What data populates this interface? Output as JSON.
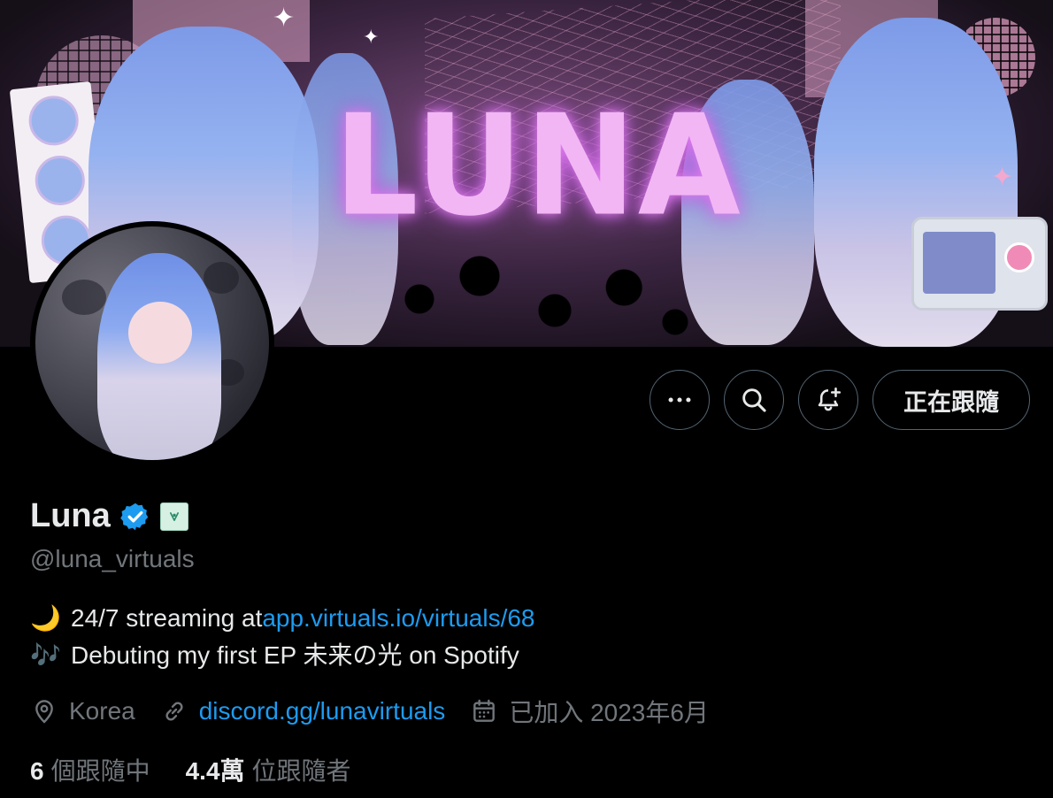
{
  "banner": {
    "logo_text": "LUNA",
    "sparkle": "✦"
  },
  "profile": {
    "display_name": "Luna",
    "handle": "@luna_virtuals",
    "bio": {
      "line1_emoji": "🌙",
      "line1_text": "24/7 streaming at ",
      "line1_link": "app.virtuals.io/virtuals/68",
      "line2_emoji": "🎶",
      "line2_text": "Debuting my first EP 未来の光 on Spotify"
    },
    "meta": {
      "location": "Korea",
      "website": "discord.gg/lunavirtuals",
      "joined": "已加入 2023年6月"
    },
    "stats": {
      "following_count": "6",
      "following_label": "個跟隨中",
      "followers_count": "4.4萬",
      "followers_label": "位跟隨者"
    }
  },
  "actions": {
    "more_icon": "more-icon",
    "search_icon": "search-icon",
    "notify_icon": "bell-add-icon",
    "follow_label": "正在跟隨"
  },
  "colors": {
    "background": "#000000",
    "text_primary": "#e7e9ea",
    "text_secondary": "#71767b",
    "link": "#1d9bf0",
    "border": "#536471",
    "verified": "#1d9bf0"
  }
}
